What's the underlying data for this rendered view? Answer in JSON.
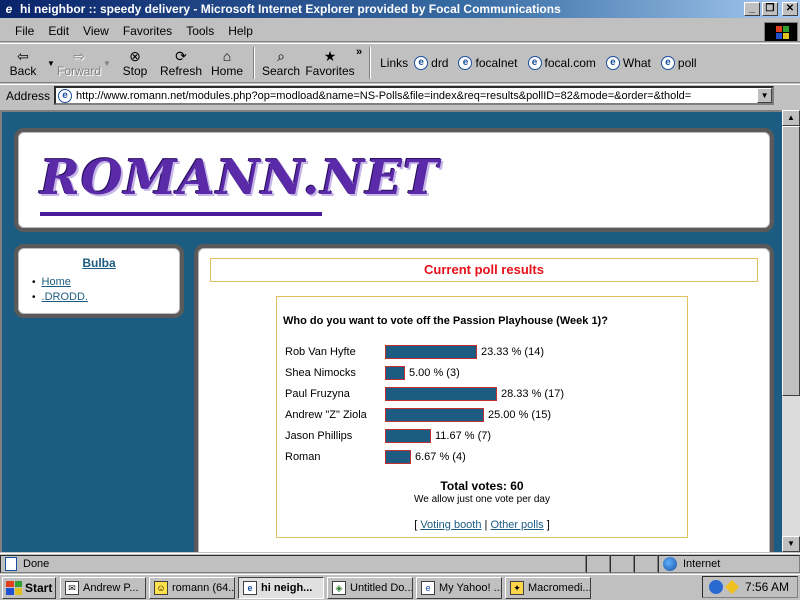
{
  "window": {
    "title": "hi neighbor :: speedy delivery - Microsoft Internet Explorer provided by Focal Communications",
    "minimize": "_",
    "maximize": "❐",
    "close": "✕"
  },
  "menu": [
    "File",
    "Edit",
    "View",
    "Favorites",
    "Tools",
    "Help"
  ],
  "toolbar": {
    "back": "Back",
    "forward": "Forward",
    "stop": "Stop",
    "refresh": "Refresh",
    "home": "Home",
    "search": "Search",
    "favorites": "Favorites",
    "chevron": "»"
  },
  "links": {
    "label": "Links",
    "items": [
      "drd",
      "focalnet",
      "focal.com",
      "What",
      "poll"
    ]
  },
  "address": {
    "label": "Address",
    "url": "http://www.romann.net/modules.php?op=modload&name=NS-Polls&file=index&req=results&pollID=82&mode=&order=&thold="
  },
  "site": {
    "logo": "ROMANN.NET"
  },
  "sidebar": {
    "title": "Bulba",
    "items": [
      "Home",
      ".DRODD."
    ]
  },
  "poll": {
    "header": "Current poll results",
    "question": "Who do you want to vote off the Passion Playhouse (Week 1)?",
    "options": [
      {
        "name": "Rob Van Hyfte",
        "percent": 23.33,
        "label": "23.33 % (14)"
      },
      {
        "name": "Shea Nimocks",
        "percent": 5.0,
        "label": "5.00 % (3)"
      },
      {
        "name": "Paul Fruzyna",
        "percent": 28.33,
        "label": "28.33 % (17)"
      },
      {
        "name": "Andrew \"Z\" Ziola",
        "percent": 25.0,
        "label": "25.00 % (15)"
      },
      {
        "name": "Jason Phillips",
        "percent": 11.67,
        "label": "11.67 % (7)"
      },
      {
        "name": "Roman",
        "percent": 6.67,
        "label": "6.67 % (4)"
      }
    ],
    "total": "Total votes: 60",
    "note": "We allow just one vote per day",
    "open_bracket": "[",
    "voting_booth": "Voting booth",
    "separator": "|",
    "other_polls": "Other polls",
    "close_bracket": "]"
  },
  "status": {
    "text": "Done",
    "zone": "Internet"
  },
  "taskbar": {
    "start": "Start",
    "tasks": [
      "Andrew P...",
      "romann (64...",
      "hi neigh...",
      "Untitled Do...",
      "My Yahoo! ...",
      "Macromedi..."
    ],
    "clock": "7:56 AM"
  }
}
